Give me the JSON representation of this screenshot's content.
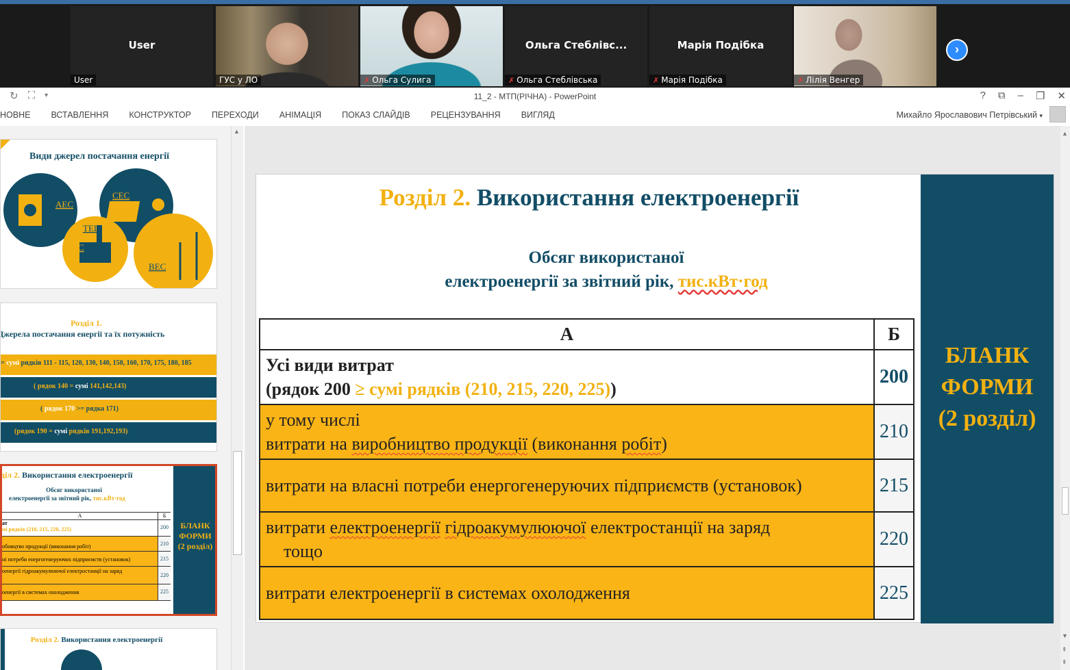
{
  "meeting": {
    "participants": [
      {
        "display": "User",
        "tag": "User",
        "muted": false,
        "video": false
      },
      {
        "display": "",
        "tag": "ГУС у ЛО",
        "muted": false,
        "video": true
      },
      {
        "display": "",
        "tag": "Ольга Сулига",
        "muted": true,
        "video": true
      },
      {
        "display": "Ольга  Стеблівс...",
        "tag": "Ольга Стеблівська",
        "muted": true,
        "video": false
      },
      {
        "display": "Марія Подібка",
        "tag": "Марія Подібка",
        "muted": true,
        "video": false
      },
      {
        "display": "",
        "tag": "Лілія Венгер",
        "muted": true,
        "video": true
      }
    ],
    "next_icon": "chevron-right-icon"
  },
  "window": {
    "title": "11_2 - МТП(РІЧНА) - PowerPoint",
    "ctrl_help": "?",
    "ctrl_restore_ribbon": "⧉",
    "ctrl_min": "–",
    "ctrl_max": "❐",
    "ctrl_close": "✕"
  },
  "ribbon": {
    "tabs": [
      "НОВНЕ",
      "ВСТАВЛЕННЯ",
      "КОНСТРУКТОР",
      "ПЕРЕХОДИ",
      "АНІМАЦІЯ",
      "ПОКАЗ СЛАЙДІВ",
      "РЕЦЕНЗУВАННЯ",
      "ВИГЛЯД"
    ],
    "user": "Михайло Ярославович Петрівський"
  },
  "thumbs": {
    "t1": {
      "title": "Види джерел постачання енергії",
      "labels": [
        "АЕС",
        "СЕС",
        "ТЕЦ",
        "ТЕС",
        "ВЕС"
      ]
    },
    "t2": {
      "title1": "Розділ 1.",
      "title2": "Джерела постачання енергії та їх потужність",
      "bar1_a": "=",
      "bar1_b": "сумі",
      "bar1_c": "рядків 111 - 115, 120, 130, 140, 150, 160, 170, 175, 180, 185",
      "bar2_a": "( рядок 140 =",
      "bar2_b": "сумі",
      "bar2_c": "141,142,143)",
      "bar3_a": "(",
      "bar3_b": "рядок 170",
      "bar3_c": ">= рядка 171)",
      "bar4_a": "(рядок 190 =",
      "bar4_b": "сумі",
      "bar4_c": "рядків 191,192,193)"
    },
    "t3": {
      "title_a": "діл 2.",
      "title_b": "Використання електроенергії",
      "sub1": "Обсяг використаної",
      "sub2": "електроенергії за звітний рік,",
      "sub3": "тис.кВт·год",
      "col_a": "А",
      "col_b": "Б",
      "rows": [
        {
          "text": "ат",
          "text2": "мі рядків (210, 215, 220, 225)",
          "num": "200"
        },
        {
          "text": "обництво продукції (виконання робіт)",
          "num": "210"
        },
        {
          "text": "ні потреби енергогенеруючих підприємств (установок)",
          "num": "215"
        },
        {
          "text": "оенергії гідроакумулюючої електростанції на заряд",
          "num": "220"
        },
        {
          "text": "оенергії в системах охолодження",
          "num": "225"
        }
      ],
      "side": [
        "БЛАНК",
        "ФОРМИ",
        "(2 розділ)"
      ]
    },
    "t4": {
      "title_a": "Розділ 2.",
      "title_b": "Використання електроенергії"
    }
  },
  "slide": {
    "title_part1": "Розділ 2.",
    "title_part2": "Використання електроенергії",
    "subtitle_line1": "Обсяг використаної",
    "subtitle_line2": "електроенергії за звітний рік,",
    "subtitle_unit": "тис.кВт·год",
    "table": {
      "col_a": "А",
      "col_b": "Б",
      "row200_line1": "Усі види витрат",
      "row200_open": "(рядок 200",
      "row200_cond": "≥ сумі рядків (210, 215, 220, 225)",
      "row200_close": ")",
      "row200_num": "200",
      "row210_line1": "у тому числі",
      "row210_line2a": "витрати на ",
      "row210_line2b": "виробництво продукції",
      "row210_line2c": " (виконання ",
      "row210_line2d": "робіт",
      "row210_line2e": ")",
      "row210_num": "210",
      "row215_text": "витрати на власні потреби енергогенеруючих підприємств (установок)",
      "row215_num": "215",
      "row220_a": "витрати ",
      "row220_b": "електроенергії",
      "row220_c": " ",
      "row220_d": "гідроакумулюючої",
      "row220_e": " електростанції на заряд",
      "row220_line2": "тощо",
      "row220_num": "220",
      "row225_text": "витрати електроенергії в системах охолодження",
      "row225_num": "225"
    },
    "side_lines": [
      "БЛАНК",
      "ФОРМИ",
      "(2 розділ)"
    ]
  },
  "colors": {
    "accent_yellow": "#f2b111",
    "dark_teal": "#124d66",
    "row_yellow": "#fbb416",
    "selection_red": "#d24726"
  }
}
